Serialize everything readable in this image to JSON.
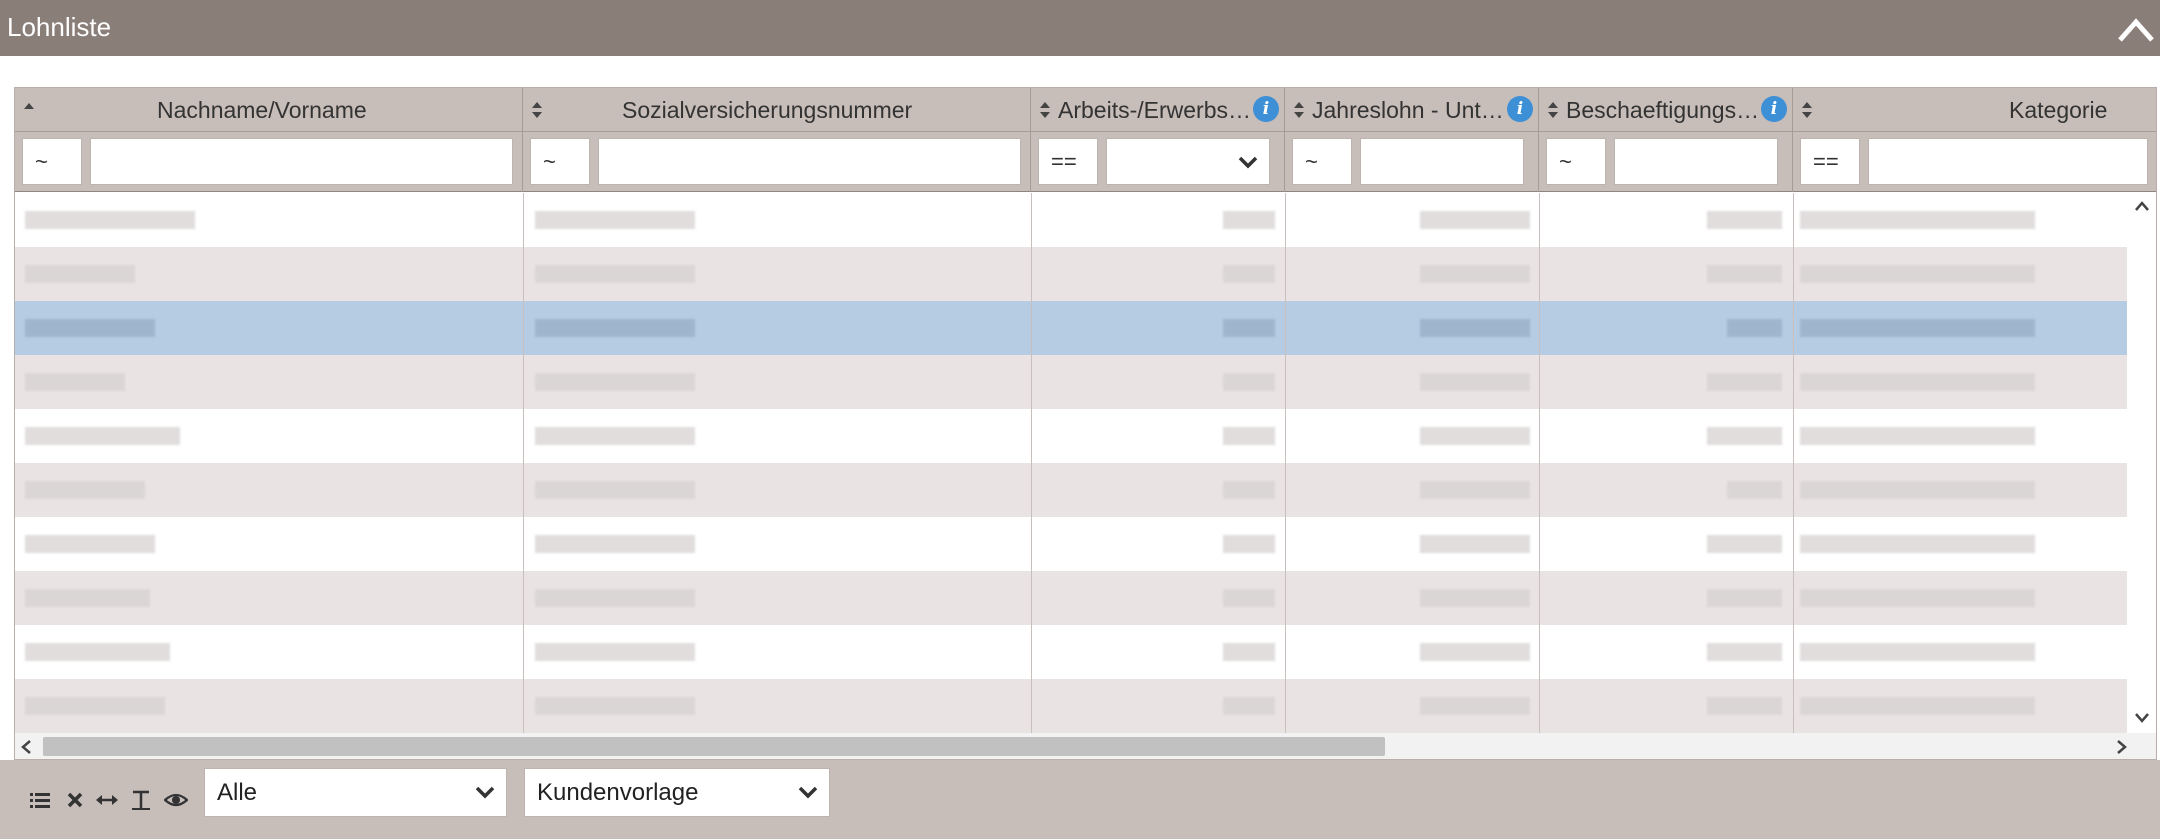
{
  "panel": {
    "title": "Lohnliste",
    "collapse_icon": "chevron-up-icon"
  },
  "columns": [
    {
      "label": "Nachname/Vorname",
      "sort": "asc",
      "filter_op": "~",
      "filter_type": "text",
      "info": false
    },
    {
      "label": "Sozialversicherungsnummer",
      "sort": "none",
      "filter_op": "~",
      "filter_type": "text",
      "info": false
    },
    {
      "label": "Arbeits-/Erwerbs…",
      "sort": "none",
      "filter_op": "==",
      "filter_type": "select",
      "info": true
    },
    {
      "label": "Jahreslohn - Unt…",
      "sort": "none",
      "filter_op": "~",
      "filter_type": "text",
      "info": true
    },
    {
      "label": "Beschaeftigungs…",
      "sort": "none",
      "filter_op": "~",
      "filter_type": "text",
      "info": true
    },
    {
      "label": "Kategorie",
      "sort": "none",
      "filter_op": "==",
      "filter_type": "text",
      "info": false
    }
  ],
  "rows": [
    {
      "state": "normal"
    },
    {
      "state": "alt"
    },
    {
      "state": "selected"
    },
    {
      "state": "alt"
    },
    {
      "state": "normal"
    },
    {
      "state": "alt"
    },
    {
      "state": "normal"
    },
    {
      "state": "alt"
    },
    {
      "state": "normal"
    }
  ],
  "footer": {
    "icons": [
      "list-icon",
      "clear-filter-icon",
      "fit-columns-icon",
      "text-format-icon",
      "eye-icon"
    ],
    "filter_select": {
      "value": "Alle"
    },
    "template_select": {
      "value": "Kundenvorlage"
    }
  },
  "colors": {
    "title_bar": "#8a7e79",
    "header": "#c7bdb9",
    "selected_row": "#b5cce3",
    "info": "#3d8fd6"
  }
}
